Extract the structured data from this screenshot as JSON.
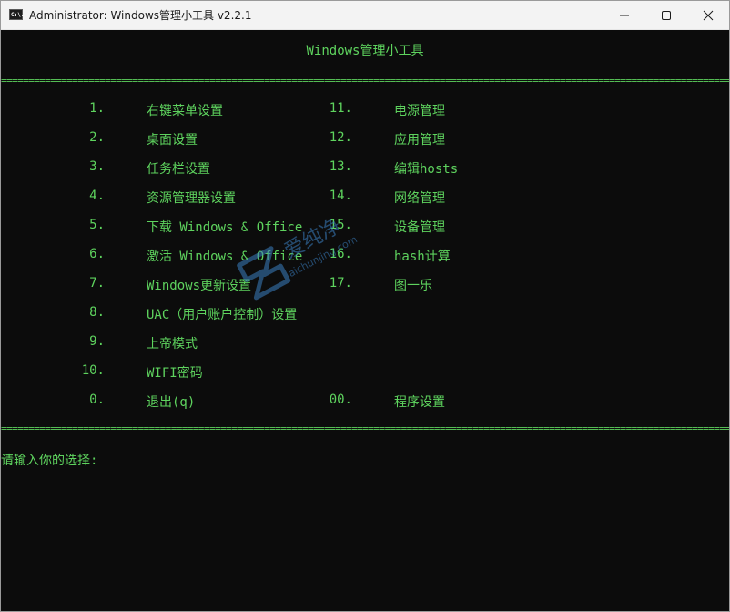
{
  "window": {
    "title": "Administrator:  Windows管理小工具 v2.2.1",
    "app_icon_text": "C:\\."
  },
  "console": {
    "header": "Windows管理小工具",
    "separator": "==============================================================================================================================================================",
    "left_menu": [
      {
        "num": "1.",
        "label": "右键菜单设置"
      },
      {
        "num": "2.",
        "label": "桌面设置"
      },
      {
        "num": "3.",
        "label": "任务栏设置"
      },
      {
        "num": "4.",
        "label": "资源管理器设置"
      },
      {
        "num": "5.",
        "label": "下载 Windows & Office"
      },
      {
        "num": "6.",
        "label": "激活 Windows & Office"
      },
      {
        "num": "7.",
        "label": "Windows更新设置"
      },
      {
        "num": "8.",
        "label": "UAC（用户账户控制）设置"
      },
      {
        "num": "9.",
        "label": "上帝模式"
      },
      {
        "num": "10.",
        "label": "WIFI密码"
      },
      {
        "num": "0.",
        "label": "退出(q)"
      }
    ],
    "right_menu": [
      {
        "num": "11.",
        "label": "电源管理"
      },
      {
        "num": "12.",
        "label": "应用管理"
      },
      {
        "num": "13.",
        "label": "编辑hosts"
      },
      {
        "num": "14.",
        "label": "网络管理"
      },
      {
        "num": "15.",
        "label": "设备管理"
      },
      {
        "num": "16.",
        "label": "hash计算"
      },
      {
        "num": "17.",
        "label": "图一乐"
      },
      {
        "num": "00.",
        "label": "程序设置"
      }
    ],
    "prompt": "请输入你的选择:"
  },
  "watermark": {
    "text": "爱纯净",
    "sub": "aichunjing.com"
  },
  "colors": {
    "console_bg": "#0c0c0c",
    "console_text": "#5ed35e",
    "titlebar_bg": "#f3f3f3"
  }
}
